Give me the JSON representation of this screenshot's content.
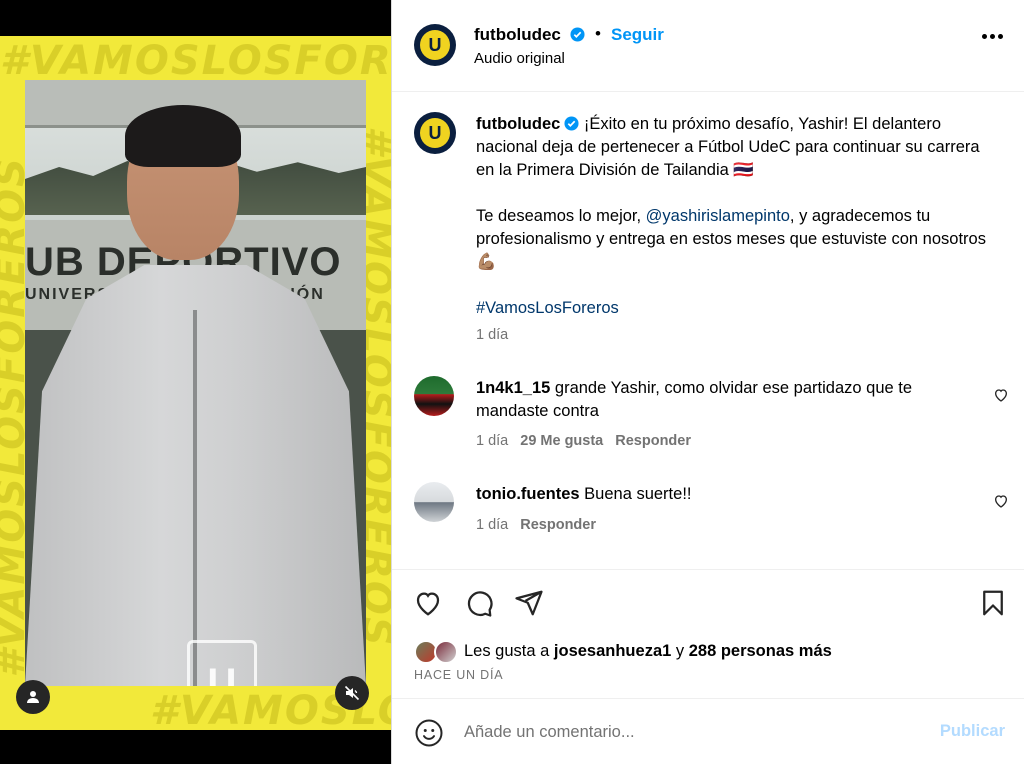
{
  "media": {
    "bg_text": "#VAMOSLOSFOREROS",
    "sign_line1": "UB DEPORTIVO",
    "sign_line2": "UNIVERSIDAD DE CONCEPCIÓN",
    "watermark_letter": "U",
    "icons": [
      "user-tag-icon",
      "mute-icon"
    ]
  },
  "header": {
    "username": "futboludec",
    "separator": "•",
    "follow_label": "Seguir",
    "subtitle": "Audio original",
    "avatar_letter": "U"
  },
  "caption": {
    "username": "futboludec",
    "line1": " ¡Éxito en tu próximo desafío, Yashir! El delantero nacional deja de pertenecer a Fútbol UdeC para continuar su carrera en la Primera División de Tailandia 🇹🇭",
    "p2_before": "Te deseamos lo mejor, ",
    "mention": "@yashirislamepinto",
    "p2_after": ", y agradecemos tu profesionalismo y entrega en estos meses que estuviste con nosotros 💪🏽",
    "hashtag": "#VamosLosForeros",
    "time": "1 día"
  },
  "comments": [
    {
      "username": "1n4k1_15",
      "text": " grande Yashir, como olvidar ese partidazo que te mandaste contra",
      "time": "1 día",
      "likes": "29 Me gusta",
      "reply": "Responder"
    },
    {
      "username": "tonio.fuentes",
      "text": " Buena suerte!!",
      "time": "1 día",
      "reply": "Responder"
    }
  ],
  "actions": {
    "likes_prefix": "Les gusta a ",
    "likes_user": "josesanhueza1",
    "likes_middle": " y ",
    "likes_count": "288 personas más",
    "time_ago": "HACE UN DÍA"
  },
  "add_comment": {
    "placeholder": "Añade un comentario...",
    "publish_label": "Publicar"
  },
  "colors": {
    "accent": "#0095f6",
    "link": "#00376b",
    "muted": "#737373",
    "brand_yellow": "#f2e93a",
    "brand_navy": "#0b1f3f"
  }
}
